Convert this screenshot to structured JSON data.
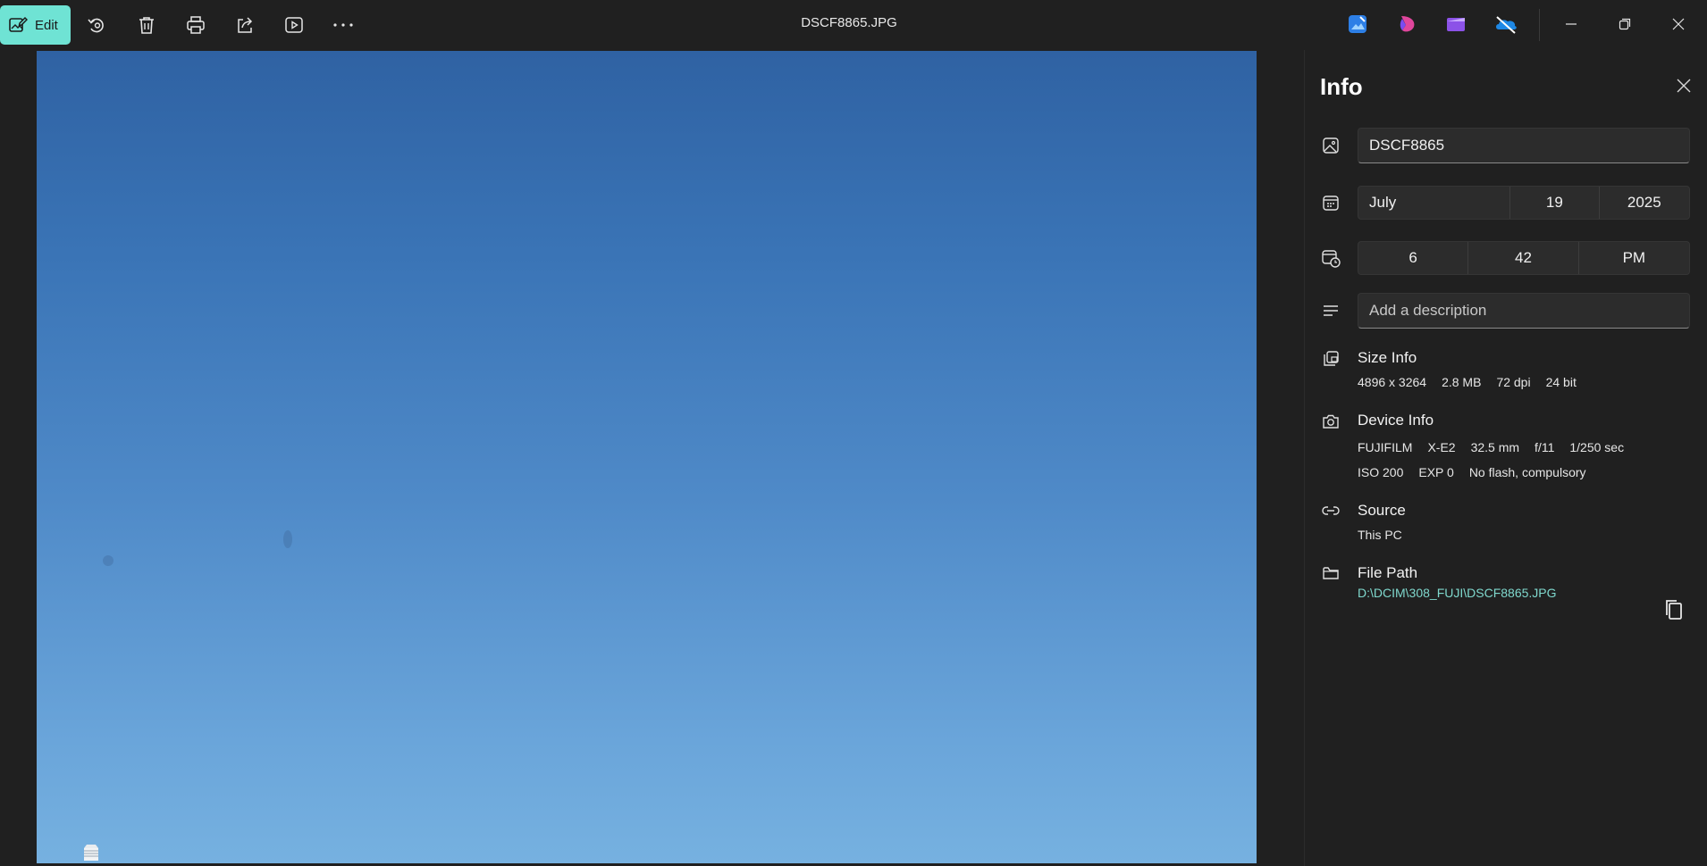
{
  "toolbar": {
    "edit_label": "Edit",
    "buttons": [
      "rotate-icon",
      "delete-icon",
      "print-icon",
      "share-icon",
      "slideshow-icon",
      "more-icon"
    ]
  },
  "window": {
    "title": "DSCF8865.JPG"
  },
  "info": {
    "heading": "Info",
    "filename": "DSCF8865",
    "date": {
      "month": "July",
      "day": "19",
      "year": "2025"
    },
    "time": {
      "hour": "6",
      "minute": "42",
      "period": "PM"
    },
    "description_placeholder": "Add a description",
    "size": {
      "title": "Size Info",
      "dimensions": "4896 x 3264",
      "filesize": "2.8 MB",
      "dpi": "72 dpi",
      "bits": "24 bit"
    },
    "device": {
      "title": "Device Info",
      "make": "FUJIFILM",
      "model": "X-E2",
      "focal": "32.5 mm",
      "aperture": "f/11",
      "shutter": "1/250 sec",
      "iso": "ISO 200",
      "exposure": "EXP 0",
      "flash": "No flash, compulsory"
    },
    "source": {
      "title": "Source",
      "value": "This PC"
    },
    "filepath": {
      "title": "File Path",
      "value": "D:\\DCIM\\308_FUJI\\DSCF8865.JPG"
    }
  },
  "colors": {
    "accent": "#6fe3d4",
    "link": "#7fd8cd",
    "background": "#202020"
  }
}
